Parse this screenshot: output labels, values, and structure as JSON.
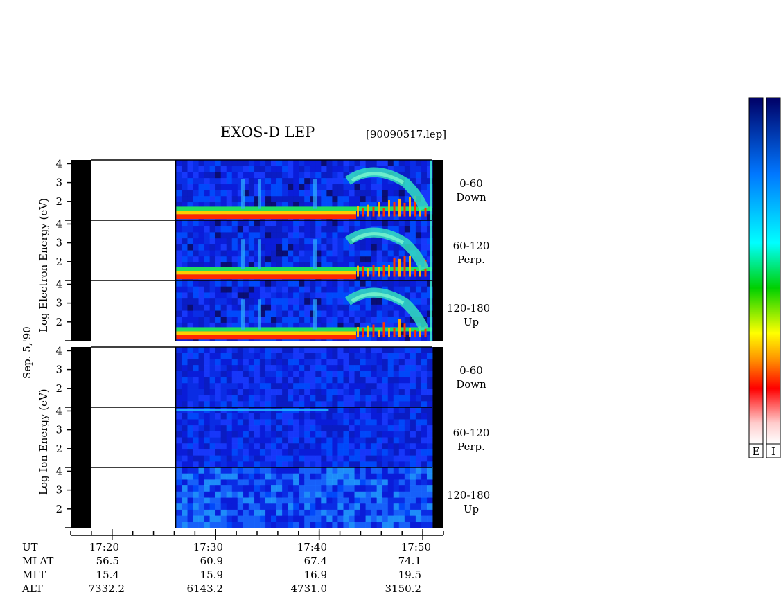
{
  "header": {
    "title": "EXOS-D LEP",
    "filename": "[90090517.lep]"
  },
  "date_label": "Sep. 5,'90",
  "panels": {
    "electron": {
      "ylabel": "Log  Electron  Energy (eV)"
    },
    "ion": {
      "ylabel": "Log   Ion   Energy (eV)"
    }
  },
  "channels": [
    {
      "angle": "0-60",
      "dir": "Down"
    },
    {
      "angle": "60-120",
      "dir": "Perp."
    },
    {
      "angle": "120-180",
      "dir": "Up"
    },
    {
      "angle": "0-60",
      "dir": "Down"
    },
    {
      "angle": "60-120",
      "dir": "Perp."
    },
    {
      "angle": "120-180",
      "dir": "Up"
    }
  ],
  "orbit": {
    "row_labels": [
      "UT",
      "MLAT",
      "MLT",
      "ALT"
    ],
    "ut": [
      "17:20",
      "17:30",
      "17:40",
      "17:50"
    ],
    "mlat": [
      "56.5",
      "60.9",
      "67.4",
      "74.1"
    ],
    "mlt": [
      "15.4",
      "15.9",
      "16.9",
      "19.5"
    ],
    "alt": [
      "7332.2",
      "6143.2",
      "4731.0",
      "3150.2"
    ]
  },
  "colorbar": {
    "labels": [
      "E",
      "I"
    ]
  },
  "colors": {
    "scale": [
      "#ffffff",
      "#ff0000",
      "#ff9900",
      "#ffff00",
      "#00c000",
      "#00ffff",
      "#0066ff",
      "#000080"
    ],
    "background": "#0a1cd8"
  },
  "chart_data": {
    "type": "heatmap",
    "title": "EXOS-D LEP",
    "x_axis": {
      "quantity": "UT",
      "range": [
        "17:16",
        "17:52"
      ],
      "ticks": [
        "17:20",
        "17:30",
        "17:40",
        "17:50"
      ]
    },
    "y_axis": {
      "label": "Log Energy (eV)",
      "range": [
        1,
        4.2
      ],
      "ticks": [
        2,
        3,
        4
      ],
      "scale": "log"
    },
    "data_start": "17:27",
    "panels": [
      {
        "species": "Electron",
        "channel": "0-60 Down"
      },
      {
        "species": "Electron",
        "channel": "60-120 Perp."
      },
      {
        "species": "Electron",
        "channel": "120-180 Up"
      },
      {
        "species": "Ion",
        "channel": "0-60 Down"
      },
      {
        "species": "Ion",
        "channel": "60-120 Perp."
      },
      {
        "species": "Ion",
        "channel": "120-180 Up"
      }
    ]
  }
}
